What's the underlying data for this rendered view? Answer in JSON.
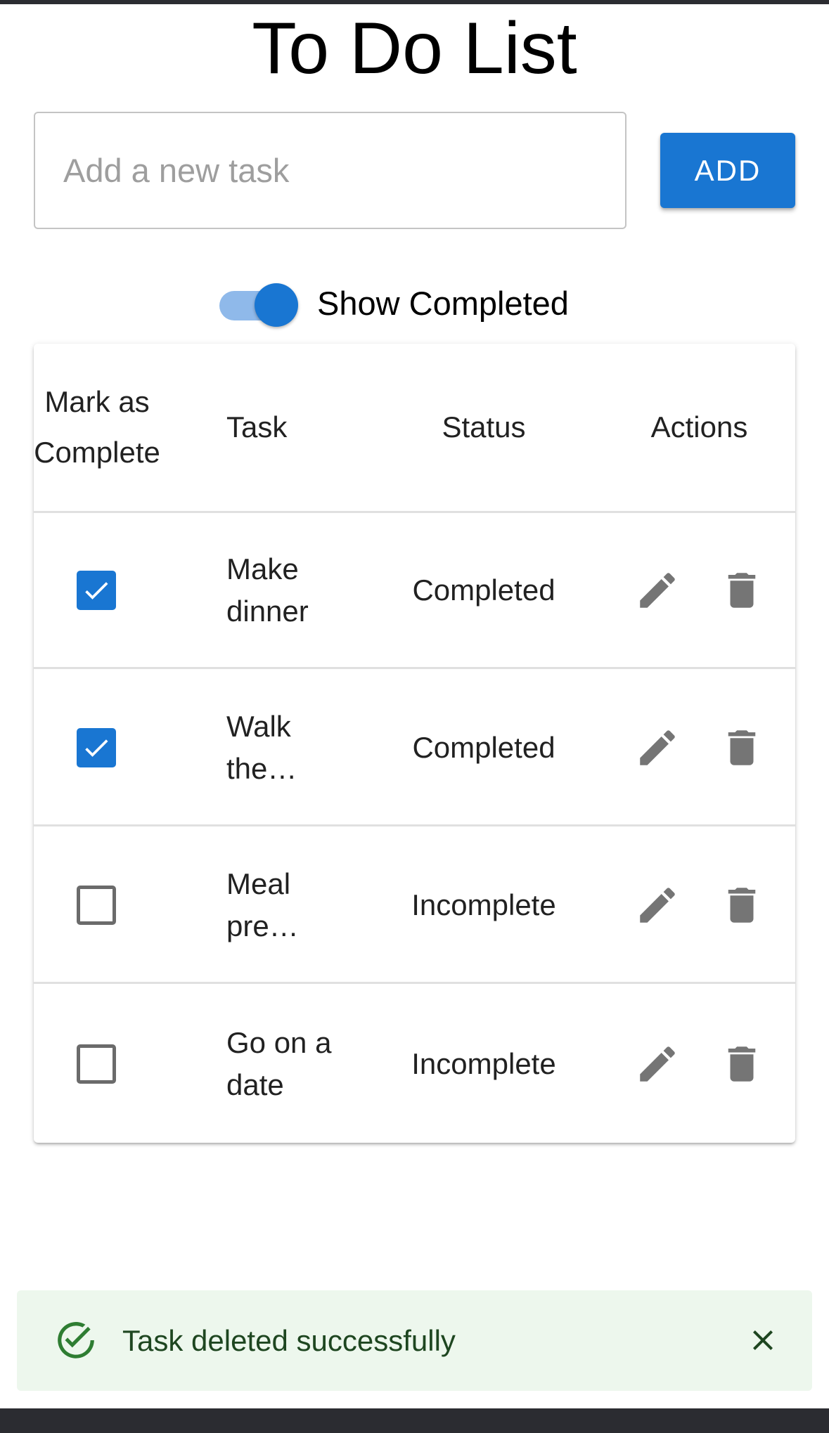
{
  "page": {
    "title": "To Do List"
  },
  "new_task": {
    "placeholder": "Add a new task",
    "value": "",
    "add_label": "ADD"
  },
  "filter": {
    "show_completed_label": "Show Completed",
    "show_completed": true
  },
  "table": {
    "headers": {
      "mark": "Mark as Complete",
      "task": "Task",
      "status": "Status",
      "actions": "Actions"
    },
    "rows": [
      {
        "task": "Make dinner",
        "status": "Completed",
        "checked": true
      },
      {
        "task": "Walk the…",
        "status": "Completed",
        "checked": true
      },
      {
        "task": "Meal pre…",
        "status": "Incomplete",
        "checked": false
      },
      {
        "task": "Go on a date",
        "status": "Incomplete",
        "checked": false
      }
    ],
    "row_icons": {
      "edit": "pencil-icon",
      "delete": "trash-icon"
    }
  },
  "snackbar": {
    "message": "Task deleted successfully",
    "severity": "success",
    "icon": "check-circle-outline-icon",
    "close_icon": "close-icon"
  },
  "colors": {
    "primary": "#1976d2",
    "switch_track": "#8fb9ea",
    "success_bg": "#edf7ed",
    "success_text": "#1e4620",
    "success_icon": "#2e7d32",
    "icon_gray": "#757575"
  }
}
